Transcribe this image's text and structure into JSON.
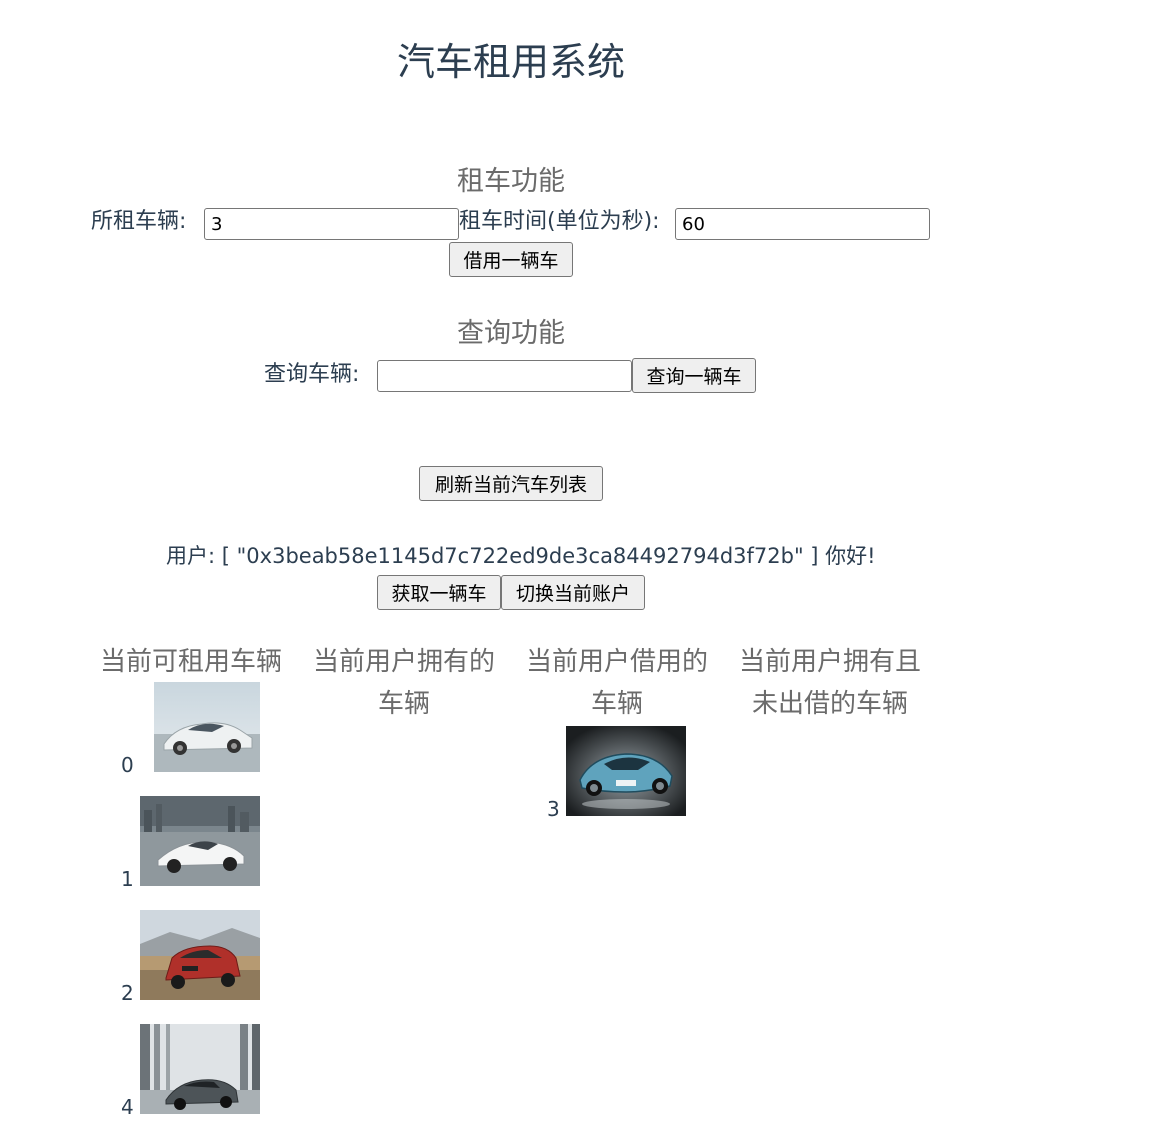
{
  "page": {
    "title": "汽车租用系统"
  },
  "rent_section": {
    "heading": "租车功能",
    "car_label": "所租车辆:",
    "car_value": "3",
    "time_label": "租车时间(单位为秒):",
    "time_value": "60",
    "rent_button": "借用一辆车"
  },
  "query_section": {
    "heading": "查询功能",
    "car_label": "查询车辆:",
    "car_value": "",
    "query_button": "查询一辆车"
  },
  "refresh_button": "刷新当前汽车列表",
  "user": {
    "prefix": "用户:",
    "address_display": "[ \"0x3beab58e1145d7c722ed9de3ca84492794d3f72b\" ]",
    "greeting": "你好!",
    "get_car_button": "获取一辆车",
    "switch_account_button": "切换当前账户"
  },
  "columns": [
    {
      "heading": "当前可租用车辆",
      "cars": [
        {
          "index": "0",
          "image": "silver-sedan"
        },
        {
          "index": "1",
          "image": "white-supercar"
        },
        {
          "index": "2",
          "image": "red-suv"
        },
        {
          "index": "4",
          "image": "grey-coupe"
        }
      ]
    },
    {
      "heading": "当前用户拥有的车辆",
      "cars": []
    },
    {
      "heading": "当前用户借用的车辆",
      "cars": [
        {
          "index": "3",
          "image": "blue-concept-car"
        }
      ]
    },
    {
      "heading": "当前用户拥有且未出借的车辆",
      "cars": []
    }
  ],
  "colors": {
    "text": "#2c3e50",
    "heading_grey": "#6b6b6b",
    "button_bg": "#efefef",
    "border": "#767676"
  }
}
